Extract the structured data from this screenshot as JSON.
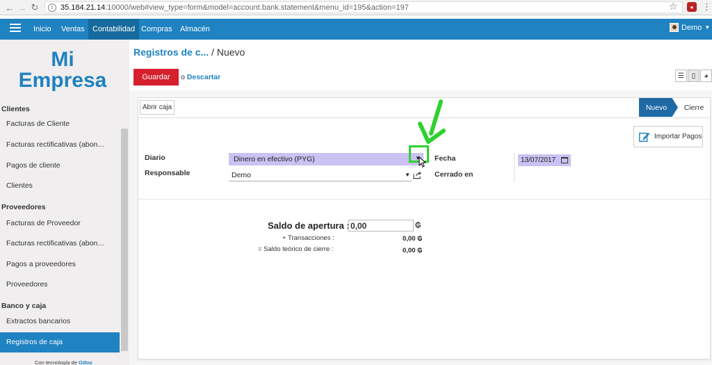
{
  "browser": {
    "url_host": "35.184.21.14",
    "url_rest": ":10000/web#view_type=form&model=account.bank.statement&menu_id=195&action=197"
  },
  "topnav": {
    "items": [
      "Inicio",
      "Ventas",
      "Contabilidad",
      "Compras",
      "Almacén"
    ],
    "active": "Contabilidad",
    "user": "Demo"
  },
  "sidebar": {
    "logo_line1": "Mi",
    "logo_line2": "Empresa",
    "sections": [
      {
        "title": "Clientes",
        "items": [
          "Facturas de Cliente",
          "Facturas rectificativas (abon…",
          "Pagos de cliente",
          "Clientes"
        ]
      },
      {
        "title": "Proveedores",
        "items": [
          "Facturas de Proveedor",
          "Facturas rectificativas (abon…",
          "Pagos a proveedores",
          "Proveedores"
        ]
      },
      {
        "title": "Banco y caja",
        "items": [
          "Extractos bancarios",
          "Registros de caja"
        ]
      }
    ],
    "active_item": "Registros de caja",
    "powered_prefix": "Con tecnología de",
    "powered_brand": "Odoo"
  },
  "control": {
    "breadcrumb_parent": "Registros de c...",
    "breadcrumb_sep": "/",
    "breadcrumb_current": "Nuevo",
    "save_label": "Guardar",
    "discard_prefix": "o",
    "discard_label": "Descartar"
  },
  "form": {
    "open_button": "Abrir caja",
    "stages": [
      "Nuevo",
      "Cierre"
    ],
    "active_stage": "Nuevo",
    "import_button": "Importar Pagos",
    "diario_label": "Diario",
    "diario_value": "Dinero en efectivo (PYG)",
    "responsable_label": "Responsable",
    "responsable_value": "Demo",
    "fecha_label": "Fecha",
    "fecha_value": "13/07/2017",
    "cerrado_label": "Cerrado en",
    "saldo_label": "Saldo de apertura :",
    "saldo_value": "0,00",
    "currency": "₲",
    "transacciones_label": "+ Transacciones :",
    "transacciones_value": "0,00 ₲",
    "teorico_label": "= Saldo teórico de cierre :",
    "teorico_value": "0,00 ₲"
  },
  "colors": {
    "brand": "#1f82c1",
    "save": "#d6202e",
    "required_field": "#c9c2f2",
    "highlight": "#2fd12f"
  }
}
